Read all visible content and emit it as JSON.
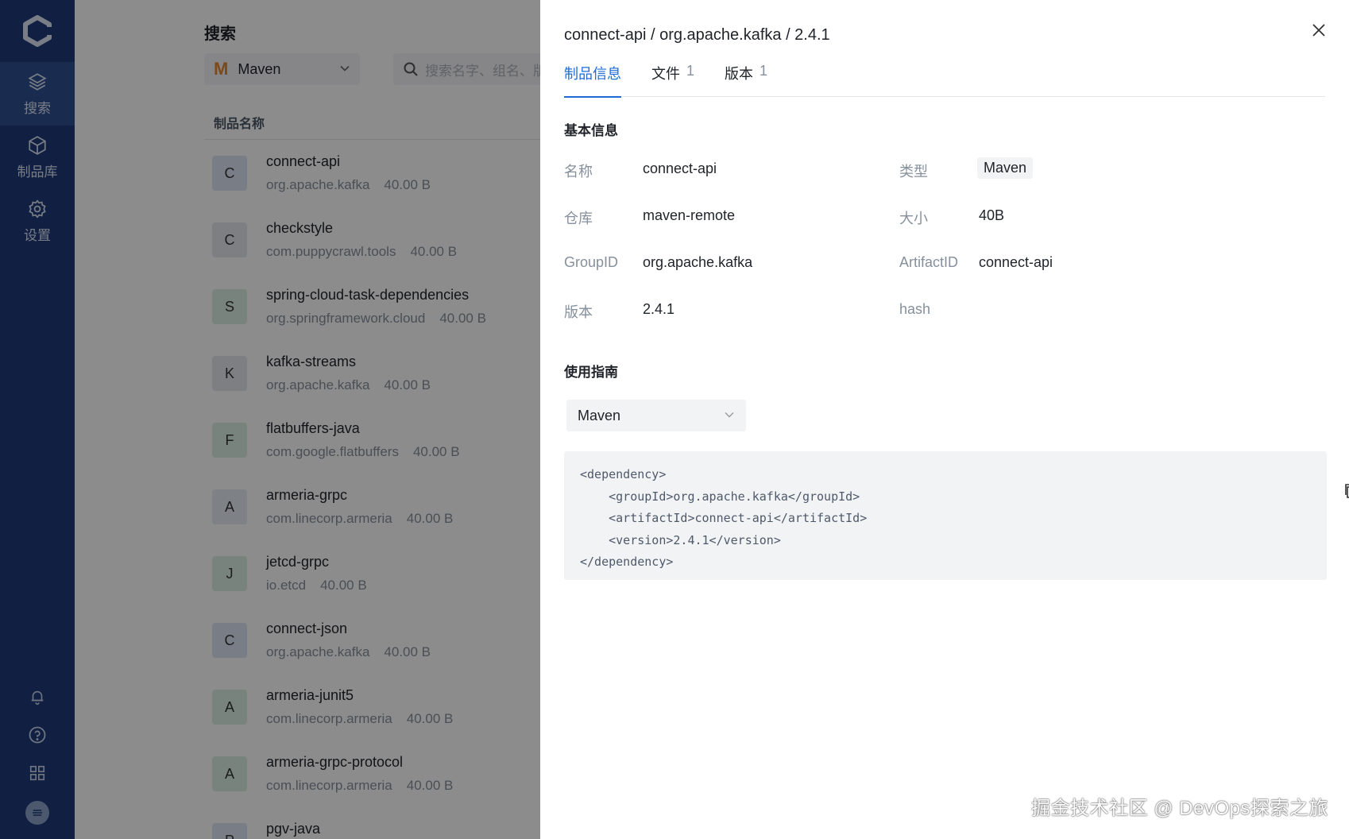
{
  "sidebar": {
    "items": [
      {
        "label": "搜索",
        "icon": "layers-icon",
        "active": true
      },
      {
        "label": "制品库",
        "icon": "cube-icon",
        "active": false
      },
      {
        "label": "设置",
        "icon": "gear-icon",
        "active": false
      }
    ],
    "bottom_icons": [
      "bell-icon",
      "help-icon",
      "apps-icon",
      "avatar"
    ]
  },
  "search_page": {
    "title": "搜索",
    "repo_type": "Maven",
    "search_placeholder": "搜索名字、组名、版",
    "column_header": "制品名称",
    "artifacts": [
      {
        "letter": "C",
        "name": "connect-api",
        "group": "org.apache.kafka",
        "size": "40.00 B"
      },
      {
        "letter": "C",
        "name": "checkstyle",
        "group": "com.puppycrawl.tools",
        "size": "40.00 B"
      },
      {
        "letter": "S",
        "name": "spring-cloud-task-dependencies",
        "group": "org.springframework.cloud",
        "size": "40.00 B"
      },
      {
        "letter": "K",
        "name": "kafka-streams",
        "group": "org.apache.kafka",
        "size": "40.00 B"
      },
      {
        "letter": "F",
        "name": "flatbuffers-java",
        "group": "com.google.flatbuffers",
        "size": "40.00 B"
      },
      {
        "letter": "A",
        "name": "armeria-grpc",
        "group": "com.linecorp.armeria",
        "size": "40.00 B"
      },
      {
        "letter": "J",
        "name": "jetcd-grpc",
        "group": "io.etcd",
        "size": "40.00 B"
      },
      {
        "letter": "C",
        "name": "connect-json",
        "group": "org.apache.kafka",
        "size": "40.00 B"
      },
      {
        "letter": "A",
        "name": "armeria-junit5",
        "group": "com.linecorp.armeria",
        "size": "40.00 B"
      },
      {
        "letter": "A",
        "name": "armeria-grpc-protocol",
        "group": "com.linecorp.armeria",
        "size": "40.00 B"
      },
      {
        "letter": "P",
        "name": "pgv-java",
        "group": "",
        "size": ""
      }
    ]
  },
  "drawer": {
    "title": "connect-api / org.apache.kafka / 2.4.1",
    "tabs": [
      {
        "label": "制品信息",
        "count": "",
        "active": true
      },
      {
        "label": "文件",
        "count": "1",
        "active": false
      },
      {
        "label": "版本",
        "count": "1",
        "active": false
      }
    ],
    "basic_info_title": "基本信息",
    "fields": {
      "name_label": "名称",
      "name": "connect-api",
      "type_label": "类型",
      "type": "Maven",
      "repo_label": "仓库",
      "repo": "maven-remote",
      "size_label": "大小",
      "size": "40B",
      "groupid_label": "GroupID",
      "groupid": "org.apache.kafka",
      "artifactid_label": "ArtifactID",
      "artifactid": "connect-api",
      "version_label": "版本",
      "version": "2.4.1",
      "hash_label": "hash",
      "hash": ""
    },
    "guide_title": "使用指南",
    "guide_select": "Maven",
    "code_lines": [
      "<dependency>",
      "    <groupId>org.apache.kafka</groupId>",
      "    <artifactId>connect-api</artifactId>",
      "    <version>2.4.1</version>",
      "</dependency>"
    ]
  },
  "watermark": "掘金技术社区 @ DevOps探索之旅",
  "colors": {
    "sidebar": "#1e3a78",
    "accent": "#1f6bd6",
    "maven_logo": "#e6842a"
  }
}
